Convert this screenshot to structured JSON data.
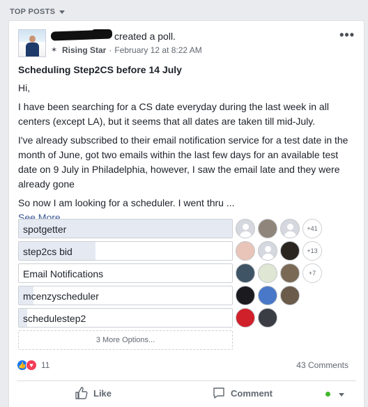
{
  "header": {
    "label": "TOP POSTS"
  },
  "post": {
    "action_text": "created a poll.",
    "badge": "Rising Star",
    "timestamp": "February 12 at 8:22 AM",
    "title": "Scheduling Step2CS before 14 July",
    "paragraphs": [
      "Hi,",
      "I have been searching for a CS date everyday during the last week in all centers (except LA), but it seems that all dates are taken till mid-July.",
      "I've already subscribed to their email notification service for a test date in the month of June, got two emails within the last few days for an available test date on 9 July in Philadelphia, however, I saw the email late and they were already gone",
      "So now I am looking for a scheduler. I went thru ..."
    ],
    "see_more": "See More"
  },
  "poll": {
    "options": [
      {
        "label": "spotgetter",
        "fill": 1.0,
        "more": "+41",
        "faces": 3
      },
      {
        "label": "step2cs bid",
        "fill": 0.36,
        "more": "+13",
        "faces": 3
      },
      {
        "label": "Email Notifications",
        "fill": 0.0,
        "more": "+7",
        "faces": 3
      },
      {
        "label": "mcenzyscheduler",
        "fill": 0.07,
        "more": "",
        "faces": 3
      },
      {
        "label": "schedulestep2",
        "fill": 0.04,
        "more": "",
        "faces": 2
      }
    ],
    "more_options": "3 More Options..."
  },
  "footer": {
    "reaction_count": "11",
    "comments": "43 Comments",
    "like_label": "Like",
    "comment_label": "Comment"
  },
  "colors": {
    "like_blue": "#1877f2",
    "love_red": "#f33e58",
    "link": "#385898",
    "online": "#42b72a"
  }
}
